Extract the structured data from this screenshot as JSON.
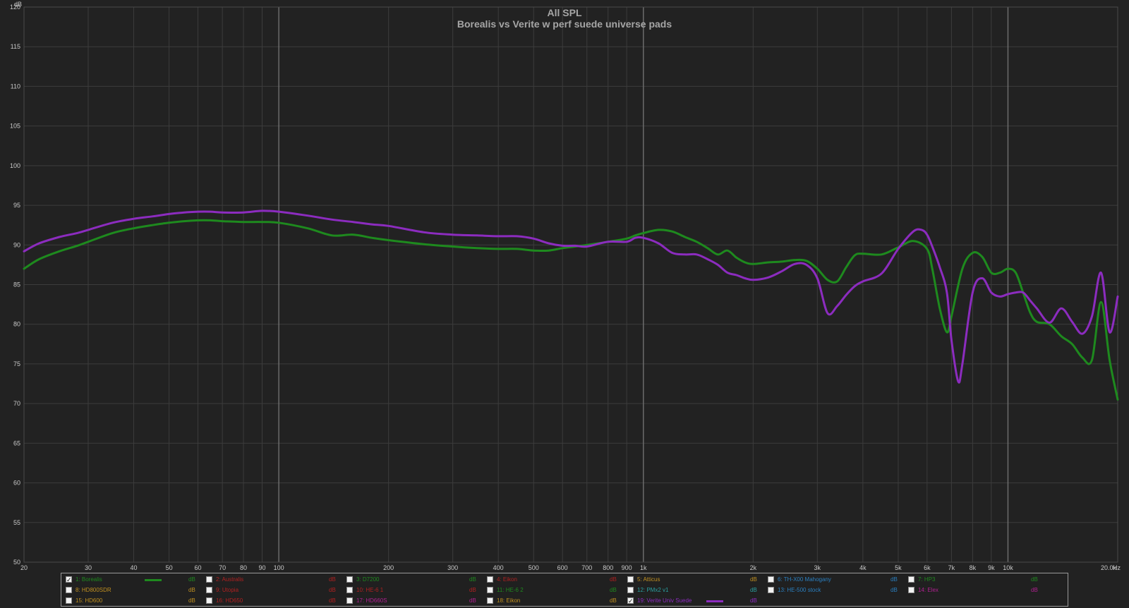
{
  "chart_data": {
    "type": "line",
    "title": "All SPL",
    "subtitle": "Borealis vs Verite w perf suede universe pads",
    "ylabel": "dB",
    "xunit": "Hz",
    "xscale": "log",
    "xlim": [
      20,
      20000
    ],
    "ylim": [
      50,
      120
    ],
    "grid": true,
    "y_ticks": [
      "120",
      "115",
      "110",
      "105",
      "100",
      "95",
      "90",
      "85",
      "80",
      "75",
      "70",
      "65",
      "60",
      "55",
      "50"
    ],
    "x_ticks": [
      "20",
      "30",
      "40",
      "50",
      "60",
      "70",
      "80",
      "90",
      "100",
      "200",
      "300",
      "400",
      "500",
      "600",
      "700",
      "800",
      "900",
      "1k",
      "2k",
      "3k",
      "4k",
      "5k",
      "6k",
      "7k",
      "8k",
      "9k",
      "10k",
      "20.0k"
    ],
    "series": [
      {
        "name": "1: Borealis",
        "color": "#1e8a1e",
        "x": [
          20,
          22,
          25,
          28,
          30,
          35,
          40,
          45,
          50,
          55,
          60,
          65,
          70,
          80,
          90,
          100,
          120,
          140,
          160,
          180,
          200,
          250,
          300,
          350,
          400,
          450,
          500,
          550,
          600,
          650,
          700,
          800,
          900,
          950,
          1000,
          1100,
          1200,
          1300,
          1400,
          1500,
          1600,
          1700,
          1800,
          1900,
          2000,
          2200,
          2400,
          2600,
          2800,
          3000,
          3200,
          3400,
          3600,
          3800,
          4000,
          4500,
          5000,
          5500,
          6000,
          6200,
          6500,
          6800,
          7000,
          7500,
          8000,
          8500,
          9000,
          9500,
          10000,
          10500,
          11000,
          11500,
          12000,
          13000,
          14000,
          15000,
          16000,
          17000,
          18000,
          19000,
          20000
        ],
        "values": [
          87.0,
          88.2,
          89.2,
          89.9,
          90.4,
          91.5,
          92.1,
          92.5,
          92.8,
          93.0,
          93.1,
          93.1,
          93.0,
          92.9,
          92.9,
          92.8,
          92.1,
          91.2,
          91.3,
          90.9,
          90.6,
          90.1,
          89.8,
          89.6,
          89.5,
          89.5,
          89.3,
          89.3,
          89.6,
          89.8,
          90.0,
          90.4,
          90.8,
          91.2,
          91.5,
          91.9,
          91.7,
          91.0,
          90.4,
          89.6,
          88.8,
          89.3,
          88.4,
          87.8,
          87.6,
          87.8,
          87.9,
          88.1,
          88.0,
          87.0,
          85.6,
          85.4,
          87.2,
          88.7,
          88.9,
          88.8,
          89.7,
          90.5,
          89.5,
          87.0,
          82.0,
          79.0,
          81.0,
          87.0,
          89.0,
          88.5,
          86.5,
          86.5,
          87.0,
          86.5,
          84.0,
          81.5,
          80.3,
          80.0,
          78.5,
          77.5,
          75.8,
          75.5,
          82.8,
          75.5,
          70.5
        ]
      },
      {
        "name": "19: Verite Univ Suede",
        "color": "#8c2cbf",
        "x": [
          20,
          22,
          25,
          28,
          30,
          35,
          40,
          45,
          50,
          55,
          60,
          65,
          70,
          80,
          90,
          100,
          120,
          140,
          160,
          180,
          200,
          250,
          300,
          350,
          400,
          450,
          500,
          550,
          600,
          650,
          700,
          800,
          900,
          950,
          1000,
          1100,
          1200,
          1300,
          1400,
          1500,
          1600,
          1700,
          1800,
          1900,
          2000,
          2200,
          2400,
          2600,
          2800,
          3000,
          3200,
          3400,
          3600,
          3800,
          4000,
          4500,
          5000,
          5500,
          5800,
          6000,
          6200,
          6500,
          6800,
          7000,
          7300,
          7500,
          8000,
          8500,
          9000,
          9500,
          10000,
          10500,
          11000,
          11500,
          12000,
          13000,
          14000,
          15000,
          16000,
          17000,
          18000,
          19000,
          20000
        ],
        "values": [
          89.2,
          90.2,
          91.0,
          91.5,
          91.9,
          92.8,
          93.3,
          93.6,
          93.9,
          94.1,
          94.2,
          94.2,
          94.1,
          94.1,
          94.3,
          94.2,
          93.7,
          93.2,
          92.9,
          92.6,
          92.4,
          91.6,
          91.3,
          91.2,
          91.1,
          91.1,
          90.8,
          90.2,
          89.9,
          89.9,
          89.8,
          90.4,
          90.4,
          90.9,
          90.9,
          90.2,
          89.0,
          88.8,
          88.8,
          88.2,
          87.5,
          86.5,
          86.2,
          85.8,
          85.6,
          85.9,
          86.7,
          87.6,
          87.5,
          85.8,
          81.4,
          82.3,
          83.7,
          84.8,
          85.4,
          86.4,
          89.5,
          91.7,
          91.9,
          91.3,
          89.8,
          87.2,
          84.0,
          78.0,
          72.8,
          75.0,
          84.0,
          85.8,
          84.0,
          83.5,
          83.8,
          84.0,
          84.0,
          83.0,
          82.0,
          80.2,
          82.0,
          80.3,
          78.8,
          81.0,
          86.5,
          79.0,
          83.5
        ]
      }
    ]
  },
  "legend": [
    {
      "label": "1: Borealis",
      "color": "#1e8a1e",
      "checked": true,
      "swatch": "#1e8a1e"
    },
    {
      "label": "2: Australis",
      "color": "#b02020",
      "checked": false
    },
    {
      "label": "3: D7200",
      "color": "#1e8a1e",
      "checked": false
    },
    {
      "label": "4: Eikon",
      "color": "#b02020",
      "checked": false
    },
    {
      "label": "5: Atticus",
      "color": "#c09020",
      "checked": false
    },
    {
      "label": "6: TH-X00 Mahogany",
      "color": "#2a7fc0",
      "checked": false
    },
    {
      "label": "7: HP3",
      "color": "#1e8a1e",
      "checked": false
    },
    {
      "label": "8: HD800SDR",
      "color": "#c09020",
      "checked": false
    },
    {
      "label": "9: Utopia",
      "color": "#b02020",
      "checked": false
    },
    {
      "label": "10: HE-6 1",
      "color": "#b02020",
      "checked": false
    },
    {
      "label": "11: HE-6 2",
      "color": "#1e8a1e",
      "checked": false
    },
    {
      "label": "12: PMx2 v1",
      "color": "#2aa0a0",
      "checked": false
    },
    {
      "label": "13: HE-500 stock",
      "color": "#2a7fc0",
      "checked": false
    },
    {
      "label": "14: Elex",
      "color": "#b02090",
      "checked": false
    },
    {
      "label": "15: HD600",
      "color": "#c09020",
      "checked": false
    },
    {
      "label": "16: HD650",
      "color": "#b02020",
      "checked": false
    },
    {
      "label": "17: HD660S",
      "color": "#b02090",
      "checked": false
    },
    {
      "label": "18: Eikon",
      "color": "#c09020",
      "checked": false
    },
    {
      "label": "19: Verite Univ Suede",
      "color": "#8c2cbf",
      "checked": true,
      "swatch": "#8c2cbf"
    }
  ],
  "legend_unit": "dB",
  "checkmark": "✓"
}
